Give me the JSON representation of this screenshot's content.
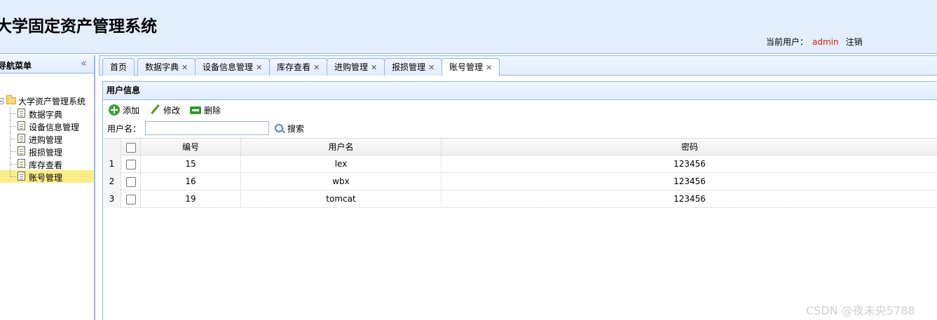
{
  "header": {
    "title": "大学固定资产管理系统",
    "current_user_label": "当前用户：",
    "username": "admin",
    "logout_label": "注销"
  },
  "sidebar": {
    "title": "导航菜单",
    "root": "大学资产管理系统",
    "items": [
      {
        "label": "数据字典"
      },
      {
        "label": "设备信息管理"
      },
      {
        "label": "进购管理"
      },
      {
        "label": "报损管理"
      },
      {
        "label": "库存查看"
      },
      {
        "label": "账号管理"
      }
    ]
  },
  "tabs": [
    {
      "label": "首页",
      "closable": false
    },
    {
      "label": "数据字典",
      "closable": true
    },
    {
      "label": "设备信息管理",
      "closable": true
    },
    {
      "label": "库存查看",
      "closable": true
    },
    {
      "label": "进购管理",
      "closable": true
    },
    {
      "label": "报损管理",
      "closable": true
    },
    {
      "label": "账号管理",
      "closable": true
    }
  ],
  "panel": {
    "title": "用户信息",
    "toolbar": {
      "add": "添加",
      "edit": "修改",
      "delete": "删除"
    },
    "search": {
      "label": "用户名：",
      "value": "",
      "button": "搜索"
    }
  },
  "grid": {
    "columns": [
      "编号",
      "用户名",
      "密码"
    ],
    "rows": [
      {
        "n": "1",
        "id": "15",
        "name": "lex",
        "pwd": "123456"
      },
      {
        "n": "2",
        "id": "16",
        "name": "wbx",
        "pwd": "123456"
      },
      {
        "n": "3",
        "id": "19",
        "name": "tomcat",
        "pwd": "123456"
      }
    ]
  },
  "watermark": "CSDN @夜未央5788"
}
